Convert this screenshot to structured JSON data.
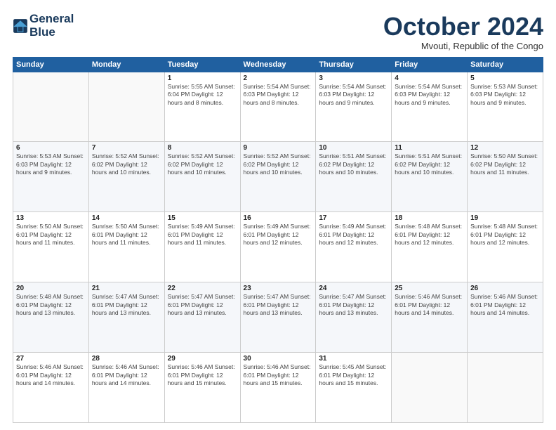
{
  "logo": {
    "line1": "General",
    "line2": "Blue"
  },
  "header": {
    "month": "October 2024",
    "location": "Mvouti, Republic of the Congo"
  },
  "weekdays": [
    "Sunday",
    "Monday",
    "Tuesday",
    "Wednesday",
    "Thursday",
    "Friday",
    "Saturday"
  ],
  "weeks": [
    [
      {
        "day": "",
        "info": ""
      },
      {
        "day": "",
        "info": ""
      },
      {
        "day": "1",
        "info": "Sunrise: 5:55 AM\nSunset: 6:04 PM\nDaylight: 12 hours\nand 8 minutes."
      },
      {
        "day": "2",
        "info": "Sunrise: 5:54 AM\nSunset: 6:03 PM\nDaylight: 12 hours\nand 8 minutes."
      },
      {
        "day": "3",
        "info": "Sunrise: 5:54 AM\nSunset: 6:03 PM\nDaylight: 12 hours\nand 9 minutes."
      },
      {
        "day": "4",
        "info": "Sunrise: 5:54 AM\nSunset: 6:03 PM\nDaylight: 12 hours\nand 9 minutes."
      },
      {
        "day": "5",
        "info": "Sunrise: 5:53 AM\nSunset: 6:03 PM\nDaylight: 12 hours\nand 9 minutes."
      }
    ],
    [
      {
        "day": "6",
        "info": "Sunrise: 5:53 AM\nSunset: 6:03 PM\nDaylight: 12 hours\nand 9 minutes."
      },
      {
        "day": "7",
        "info": "Sunrise: 5:52 AM\nSunset: 6:02 PM\nDaylight: 12 hours\nand 10 minutes."
      },
      {
        "day": "8",
        "info": "Sunrise: 5:52 AM\nSunset: 6:02 PM\nDaylight: 12 hours\nand 10 minutes."
      },
      {
        "day": "9",
        "info": "Sunrise: 5:52 AM\nSunset: 6:02 PM\nDaylight: 12 hours\nand 10 minutes."
      },
      {
        "day": "10",
        "info": "Sunrise: 5:51 AM\nSunset: 6:02 PM\nDaylight: 12 hours\nand 10 minutes."
      },
      {
        "day": "11",
        "info": "Sunrise: 5:51 AM\nSunset: 6:02 PM\nDaylight: 12 hours\nand 10 minutes."
      },
      {
        "day": "12",
        "info": "Sunrise: 5:50 AM\nSunset: 6:02 PM\nDaylight: 12 hours\nand 11 minutes."
      }
    ],
    [
      {
        "day": "13",
        "info": "Sunrise: 5:50 AM\nSunset: 6:01 PM\nDaylight: 12 hours\nand 11 minutes."
      },
      {
        "day": "14",
        "info": "Sunrise: 5:50 AM\nSunset: 6:01 PM\nDaylight: 12 hours\nand 11 minutes."
      },
      {
        "day": "15",
        "info": "Sunrise: 5:49 AM\nSunset: 6:01 PM\nDaylight: 12 hours\nand 11 minutes."
      },
      {
        "day": "16",
        "info": "Sunrise: 5:49 AM\nSunset: 6:01 PM\nDaylight: 12 hours\nand 12 minutes."
      },
      {
        "day": "17",
        "info": "Sunrise: 5:49 AM\nSunset: 6:01 PM\nDaylight: 12 hours\nand 12 minutes."
      },
      {
        "day": "18",
        "info": "Sunrise: 5:48 AM\nSunset: 6:01 PM\nDaylight: 12 hours\nand 12 minutes."
      },
      {
        "day": "19",
        "info": "Sunrise: 5:48 AM\nSunset: 6:01 PM\nDaylight: 12 hours\nand 12 minutes."
      }
    ],
    [
      {
        "day": "20",
        "info": "Sunrise: 5:48 AM\nSunset: 6:01 PM\nDaylight: 12 hours\nand 13 minutes."
      },
      {
        "day": "21",
        "info": "Sunrise: 5:47 AM\nSunset: 6:01 PM\nDaylight: 12 hours\nand 13 minutes."
      },
      {
        "day": "22",
        "info": "Sunrise: 5:47 AM\nSunset: 6:01 PM\nDaylight: 12 hours\nand 13 minutes."
      },
      {
        "day": "23",
        "info": "Sunrise: 5:47 AM\nSunset: 6:01 PM\nDaylight: 12 hours\nand 13 minutes."
      },
      {
        "day": "24",
        "info": "Sunrise: 5:47 AM\nSunset: 6:01 PM\nDaylight: 12 hours\nand 13 minutes."
      },
      {
        "day": "25",
        "info": "Sunrise: 5:46 AM\nSunset: 6:01 PM\nDaylight: 12 hours\nand 14 minutes."
      },
      {
        "day": "26",
        "info": "Sunrise: 5:46 AM\nSunset: 6:01 PM\nDaylight: 12 hours\nand 14 minutes."
      }
    ],
    [
      {
        "day": "27",
        "info": "Sunrise: 5:46 AM\nSunset: 6:01 PM\nDaylight: 12 hours\nand 14 minutes."
      },
      {
        "day": "28",
        "info": "Sunrise: 5:46 AM\nSunset: 6:01 PM\nDaylight: 12 hours\nand 14 minutes."
      },
      {
        "day": "29",
        "info": "Sunrise: 5:46 AM\nSunset: 6:01 PM\nDaylight: 12 hours\nand 15 minutes."
      },
      {
        "day": "30",
        "info": "Sunrise: 5:46 AM\nSunset: 6:01 PM\nDaylight: 12 hours\nand 15 minutes."
      },
      {
        "day": "31",
        "info": "Sunrise: 5:45 AM\nSunset: 6:01 PM\nDaylight: 12 hours\nand 15 minutes."
      },
      {
        "day": "",
        "info": ""
      },
      {
        "day": "",
        "info": ""
      }
    ]
  ]
}
